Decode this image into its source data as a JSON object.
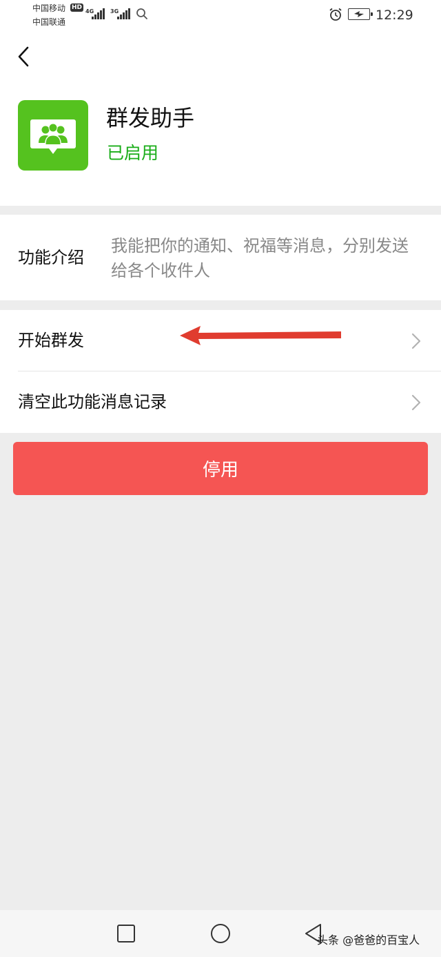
{
  "status_bar": {
    "carrier_1": "中国移动",
    "carrier_2": "中国联通",
    "hd_badge": "HD",
    "network_1": "4G",
    "network_2": "3G",
    "time": "12:29"
  },
  "header": {
    "app_name": "群发助手",
    "app_status": "已启用"
  },
  "intro": {
    "label": "功能介绍",
    "text": "我能把你的通知、祝福等消息，分别发送给各个收件人"
  },
  "list": {
    "items": [
      {
        "label": "开始群发"
      },
      {
        "label": "清空此功能消息记录"
      }
    ]
  },
  "disable_button": {
    "label": "停用"
  },
  "watermark": "头条 @爸爸的百宝人",
  "colors": {
    "accent_green": "#1aad19",
    "icon_green": "#55c21f",
    "danger_red": "#f55553",
    "annotation_red": "#e03c2f"
  },
  "icons": {
    "back": "chevron-left-icon",
    "list_arrow": "chevron-right-icon",
    "app": "group-chat-icon"
  }
}
